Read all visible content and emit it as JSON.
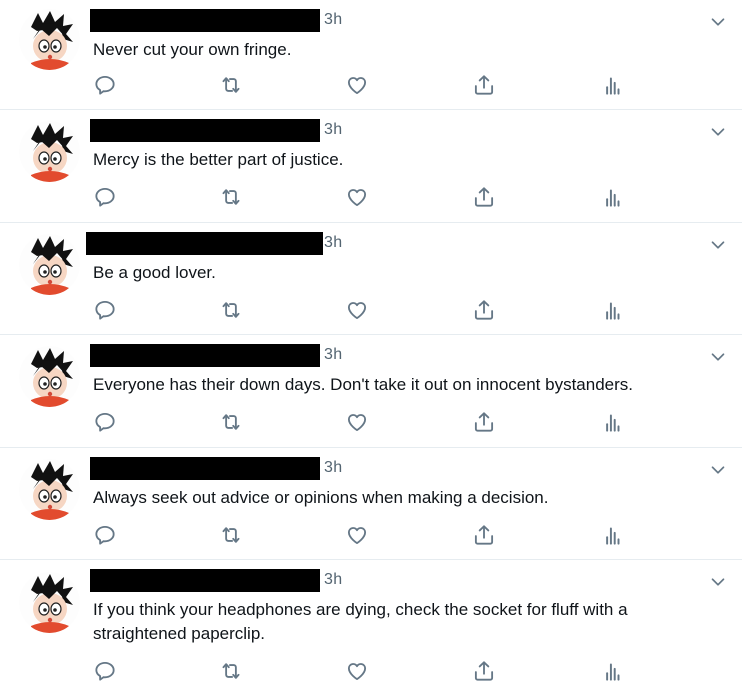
{
  "tweets": [
    {
      "time": "3h",
      "text": "Never cut your own fringe."
    },
    {
      "time": "3h",
      "text": "Mercy is the better part of justice."
    },
    {
      "time": "3h",
      "text": "Be a good lover."
    },
    {
      "time": "3h",
      "text": "Everyone has their down days. Don't take it out on innocent bystanders."
    },
    {
      "time": "3h",
      "text": "Always seek out advice or opinions when making a decision."
    },
    {
      "time": "3h",
      "text": "If you think your headphones are dying, check the socket for fluff with a straightened paperclip."
    }
  ],
  "colors": {
    "icon": "#657786",
    "divider": "#e6ecf0",
    "redacted": "#000000"
  },
  "icons": [
    "reply-icon",
    "retweet-icon",
    "like-icon",
    "share-icon",
    "analytics-icon",
    "chevron-down-icon"
  ]
}
